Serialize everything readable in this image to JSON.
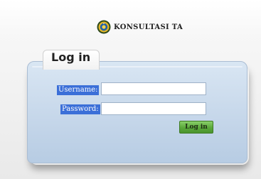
{
  "header": {
    "brand_name": "KONSULTASI TA",
    "emblem_icon": "university-seal-icon"
  },
  "login_panel": {
    "tab_title": "Log in",
    "username_label": "Username:",
    "username_value": "",
    "password_label": "Password:",
    "password_value": "",
    "submit_label": "Log in"
  },
  "colors": {
    "panel_blue": "#c6d7ea",
    "label_highlight": "#3b6fd8",
    "button_green": "#5aa83a"
  }
}
